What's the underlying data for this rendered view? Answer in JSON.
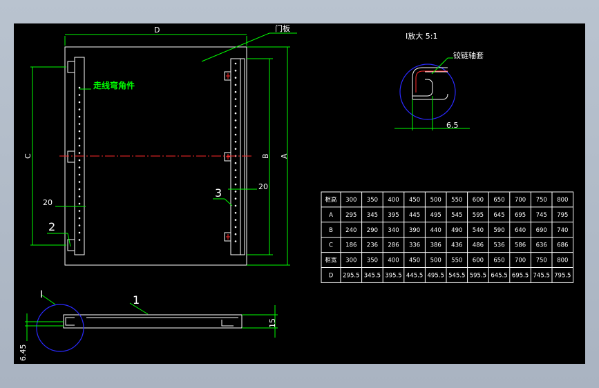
{
  "labels": {
    "dim_D": "D",
    "dim_C": "C",
    "dim_B": "B",
    "dim_A": "A",
    "door_panel": "门板",
    "cable_bend": "走线弯角件",
    "dim_20_left": "20",
    "dim_20_right": "20",
    "item_2": "2",
    "item_3": "3",
    "item_1": "1",
    "detail_I": "I",
    "dim_15": "15",
    "dim_645": "6.45",
    "detail_title": "I放大 5:1",
    "hinge_sleeve": "铰链轴套",
    "dim_65": "6.5"
  },
  "table": {
    "rows": [
      [
        "柜高",
        "300",
        "350",
        "400",
        "450",
        "500",
        "550",
        "600",
        "650",
        "700",
        "750",
        "800"
      ],
      [
        "A",
        "295",
        "345",
        "395",
        "445",
        "495",
        "545",
        "595",
        "645",
        "695",
        "745",
        "795"
      ],
      [
        "B",
        "240",
        "290",
        "340",
        "390",
        "440",
        "490",
        "540",
        "590",
        "640",
        "690",
        "740"
      ],
      [
        "C",
        "186",
        "236",
        "286",
        "336",
        "386",
        "436",
        "486",
        "536",
        "586",
        "636",
        "686"
      ],
      [
        "柜宽",
        "300",
        "350",
        "400",
        "450",
        "500",
        "550",
        "600",
        "650",
        "700",
        "750",
        "800"
      ],
      [
        "D",
        "295.5",
        "345.5",
        "395.5",
        "445.5",
        "495.5",
        "545.5",
        "595.5",
        "645.5",
        "695.5",
        "745.5",
        "795.5"
      ]
    ]
  }
}
